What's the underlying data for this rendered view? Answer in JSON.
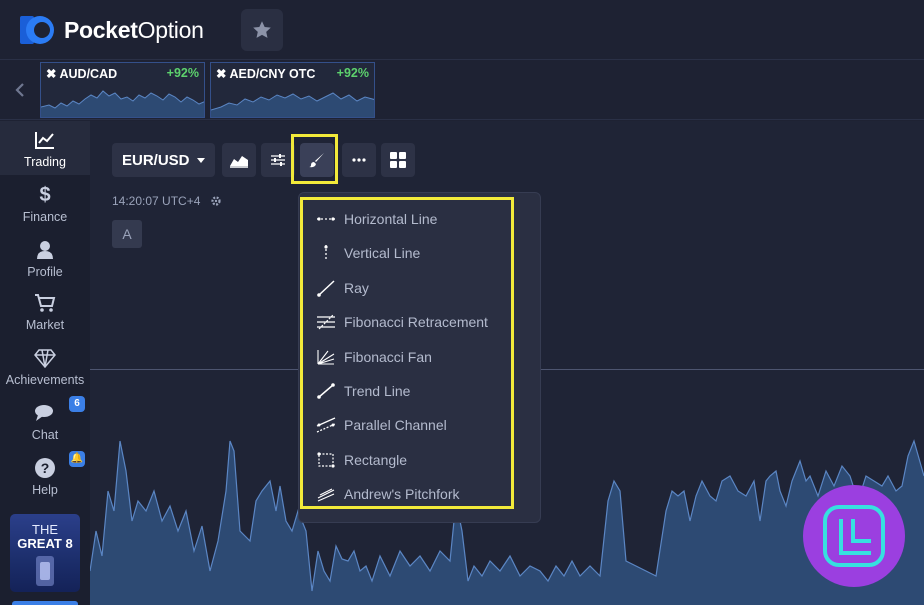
{
  "app": {
    "logo_bold": "Pocket",
    "logo_light": "Option"
  },
  "header": {
    "favorite_icon": "star-icon"
  },
  "assets": [
    {
      "name": "AUD/CAD",
      "payout": "+92%"
    },
    {
      "name": "AED/CNY OTC",
      "payout": "+92%"
    }
  ],
  "sidebar": {
    "items": [
      {
        "label": "Trading",
        "icon": "chart-line-icon",
        "active": true
      },
      {
        "label": "Finance",
        "icon": "dollar-icon"
      },
      {
        "label": "Profile",
        "icon": "user-icon"
      },
      {
        "label": "Market",
        "icon": "cart-icon"
      },
      {
        "label": "Achievements",
        "icon": "diamond-icon"
      },
      {
        "label": "Chat",
        "icon": "chat-icon",
        "badge": "6"
      },
      {
        "label": "Help",
        "icon": "help-icon"
      }
    ],
    "promo": {
      "line1": "THE",
      "line2": "GREAT 8"
    }
  },
  "toolbar": {
    "pair": "EUR/USD",
    "time": "14:20:07 UTC+4",
    "a_label": "A"
  },
  "drawing_menu": {
    "items": [
      {
        "label": "Horizontal Line",
        "icon": "horizontal-line-icon"
      },
      {
        "label": "Vertical Line",
        "icon": "vertical-line-icon"
      },
      {
        "label": "Ray",
        "icon": "ray-icon"
      },
      {
        "label": "Fibonacci Retracement",
        "icon": "fibonacci-retracement-icon"
      },
      {
        "label": "Fibonacci Fan",
        "icon": "fibonacci-fan-icon"
      },
      {
        "label": "Trend Line",
        "icon": "trend-line-icon"
      },
      {
        "label": "Parallel Channel",
        "icon": "parallel-channel-icon"
      },
      {
        "label": "Rectangle",
        "icon": "rectangle-icon"
      },
      {
        "label": "Andrew's Pitchfork",
        "icon": "pitchfork-icon"
      }
    ]
  },
  "colors": {
    "background": "#1e2233",
    "highlight": "#f2ea3a",
    "positive": "#5dd16d",
    "accent": "#3b7fe6",
    "chart_fill": "#2d4a73"
  }
}
